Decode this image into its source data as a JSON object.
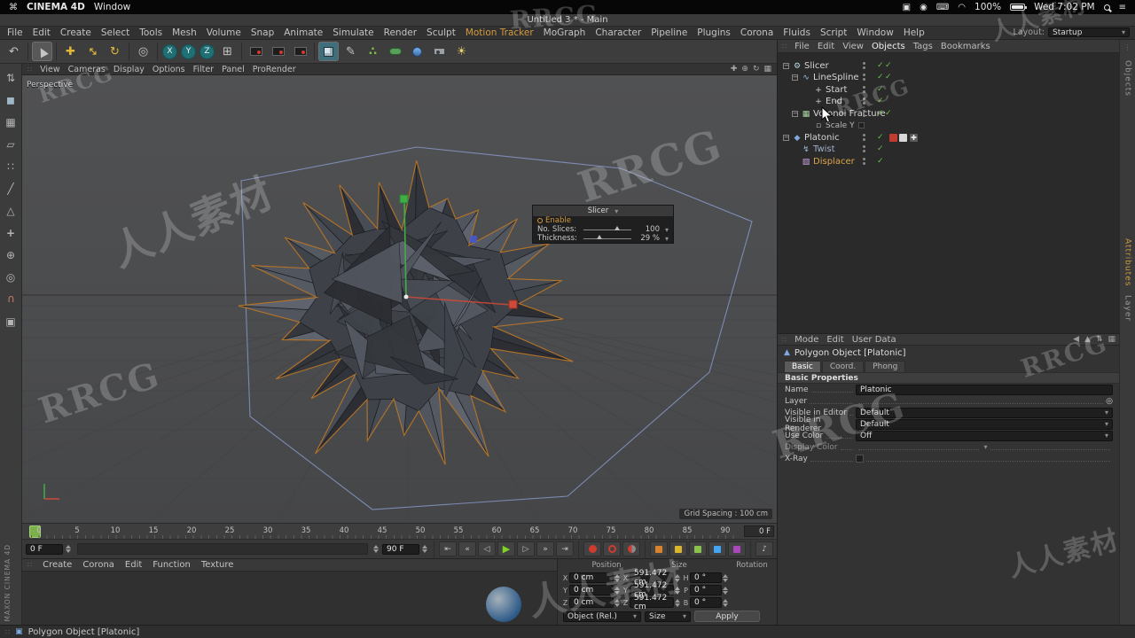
{
  "mac_menubar": {
    "app_name": "CINEMA 4D",
    "window_menu": "Window",
    "battery": "100%",
    "clock": "Wed 7:02 PM"
  },
  "window_title": "Untitled 3 * - Main",
  "app_menu": {
    "items": [
      "File",
      "Edit",
      "Create",
      "Select",
      "Tools",
      "Mesh",
      "Volume",
      "Snap",
      "Animate",
      "Simulate",
      "Render",
      "Sculpt",
      "Motion Tracker",
      "MoGraph",
      "Character",
      "Pipeline",
      "Plugins",
      "Corona",
      "Fluids",
      "Script",
      "Window",
      "Help"
    ],
    "layout_label": "Layout:",
    "layout_value": "Startup"
  },
  "toolbar": {
    "axis_x": "X",
    "axis_y": "Y",
    "axis_z": "Z"
  },
  "viewport": {
    "menu": [
      "View",
      "Cameras",
      "Display",
      "Options",
      "Filter",
      "Panel",
      "ProRender"
    ],
    "camera_label": "Perspective",
    "grid_spacing": "Grid Spacing : 100 cm"
  },
  "hud": {
    "title": "Slicer",
    "enable_label": "Enable",
    "slices_label": "No. Slices:",
    "slices_value": "100",
    "thickness_label": "Thickness:",
    "thickness_value": "29 %"
  },
  "timeline": {
    "ticks": [
      "0",
      "5",
      "10",
      "15",
      "20",
      "25",
      "30",
      "35",
      "40",
      "45",
      "50",
      "55",
      "60",
      "65",
      "70",
      "75",
      "80",
      "85",
      "90"
    ],
    "start_value": "0 F",
    "end_value": "90 F",
    "current_value": "0 F"
  },
  "material_manager": {
    "menu": [
      "Create",
      "Corona",
      "Edit",
      "Function",
      "Texture"
    ]
  },
  "coordinates": {
    "headers": [
      "Position",
      "Size",
      "Rotation"
    ],
    "rows": [
      {
        "p_label": "X",
        "p": "0 cm",
        "s_label": "X",
        "s": "591.472 cm",
        "r_label": "H",
        "r": "0 °"
      },
      {
        "p_label": "Y",
        "p": "0 cm",
        "s_label": "Y",
        "s": "591.472 cm",
        "r_label": "P",
        "r": "0 °"
      },
      {
        "p_label": "Z",
        "p": "0 cm",
        "s_label": "Z",
        "s": "591.472 cm",
        "r_label": "B",
        "r": "0 °"
      }
    ],
    "mode_left": "Object (Rel.)",
    "mode_right": "Size",
    "apply_label": "Apply"
  },
  "object_manager": {
    "menu": [
      "File",
      "Edit",
      "View",
      "Objects",
      "Tags",
      "Bookmarks"
    ],
    "items": [
      {
        "label": "Slicer",
        "color": "#d6d6d6"
      },
      {
        "label": "LineSpline",
        "color": "#d6d6d6"
      },
      {
        "label": "Start",
        "color": "#d6d6d6"
      },
      {
        "label": "End",
        "color": "#d6d6d6"
      },
      {
        "label": "Voronoi Fracture",
        "color": "#d6d6d6"
      },
      {
        "label": "Scale Y",
        "color": "#b9b9b9"
      },
      {
        "label": "Platonic",
        "color": "#d6d6d6"
      },
      {
        "label": "Twist",
        "color": "#9fb0c8"
      },
      {
        "label": "Displacer",
        "color": "#dca449"
      }
    ]
  },
  "attribute_manager": {
    "menu": [
      "Mode",
      "Edit",
      "User Data"
    ],
    "title": "Polygon Object [Platonic]",
    "tabs": [
      "Basic",
      "Coord.",
      "Phong"
    ],
    "section": "Basic Properties",
    "name_label": "Name",
    "name_value": "Platonic",
    "layer_label": "Layer",
    "vis_editor_label": "Visible in Editor",
    "vis_editor_value": "Default",
    "vis_renderer_label": "Visible in Renderer",
    "vis_renderer_value": "Default",
    "use_color_label": "Use Color",
    "use_color_value": "Off",
    "display_color_label": "Display Color",
    "xray_label": "X-Ray"
  },
  "side_tabs": {
    "objects": "Objects",
    "attributes": "Attributes",
    "layer": "Layer"
  },
  "status_bar": {
    "text": "Polygon Object [Platonic]"
  },
  "branding": {
    "vertical_label": "MAXON CINEMA 4D"
  },
  "watermarks": {
    "rrcg": "RRCG",
    "cn": "人人素材"
  },
  "colors": {
    "accent_orange": "#d29a3f",
    "check_green": "#6cbf4b",
    "axis_green": "#3fae46",
    "axis_red": "#cf4a38",
    "selection_orange": "#bf7c2e",
    "spline_blue": "#93a7e0",
    "play_green": "#7ed321"
  }
}
